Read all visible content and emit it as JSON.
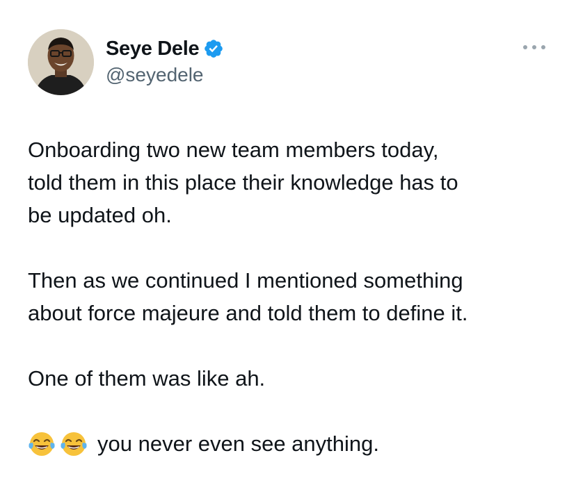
{
  "user": {
    "display_name": "Seye Dele",
    "handle": "@seyedele",
    "verified": true,
    "verified_color": "#1d9bf0"
  },
  "tweet": {
    "paragraphs": [
      "Onboarding two new team members today,\ntold them in this place their knowledge has to\nbe updated oh.",
      "Then as we continued I mentioned something\nabout force majeure and told them to define it.",
      "One of them was like ah."
    ],
    "last_line": {
      "emojis": [
        "face-with-tears-of-joy-emoji",
        "face-with-tears-of-joy-emoji"
      ],
      "text": "you never even see anything."
    }
  },
  "icons": {
    "more": "more-horizontal-icon",
    "verified": "verified-badge-icon"
  },
  "colors": {
    "text_primary": "#0f1419",
    "text_secondary": "#536471",
    "more_dots": "#9aa5ae"
  }
}
